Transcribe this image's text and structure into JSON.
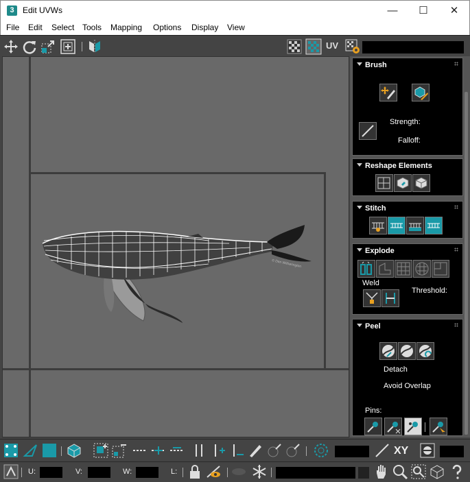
{
  "window": {
    "app_icon": "3",
    "title": "Edit UVWs",
    "minimize": "—",
    "maximize": "☐",
    "close": "✕"
  },
  "menu": [
    "File",
    "Edit",
    "Select",
    "Tools",
    "Mapping",
    "Options",
    "Display",
    "View"
  ],
  "toolbar": {
    "uv_label": "UV"
  },
  "viewport": {
    "watermark": "© Dan Witherington"
  },
  "panel": {
    "brush": {
      "title": "Brush",
      "strength_label": "Strength:",
      "falloff_label": "Falloff:"
    },
    "reshape": {
      "title": "Reshape Elements"
    },
    "stitch": {
      "title": "Stitch"
    },
    "explode": {
      "title": "Explode",
      "weld_label": "Weld",
      "threshold_label": "Threshold:"
    },
    "peel": {
      "title": "Peel",
      "detach_label": "Detach",
      "avoid_overlap_label": "Avoid Overlap",
      "pins_label": "Pins:"
    }
  },
  "bottom": {
    "xy_label": "XY",
    "u_label": "U:",
    "v_label": "V:",
    "w_label": "W:",
    "l_label": "L:"
  },
  "colors": {
    "accent": "#1a9aa8",
    "viewport_bg": "#696969",
    "panel_bg": "#000000"
  }
}
